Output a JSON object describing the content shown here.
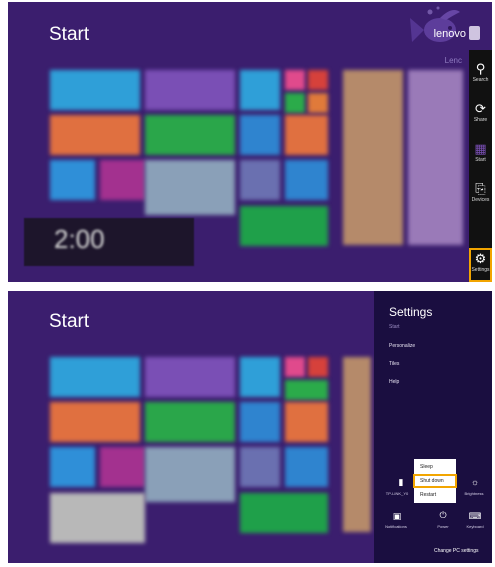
{
  "top": {
    "start_title": "Start",
    "user_name": "lenovo",
    "user_name_faint": "Lenc",
    "clock_time": "2:00",
    "charms": [
      {
        "label": "Search",
        "icon": "search-icon"
      },
      {
        "label": "Share",
        "icon": "share-icon"
      },
      {
        "label": "Start",
        "icon": "windows-logo-icon"
      },
      {
        "label": "Devices",
        "icon": "devices-icon"
      },
      {
        "label": "Settings",
        "icon": "gear-icon"
      }
    ],
    "selected_charm": "Settings"
  },
  "bottom": {
    "start_title": "Start",
    "settings": {
      "title": "Settings",
      "subtitle": "Start",
      "links": [
        "Personalize",
        "Tiles",
        "Help"
      ],
      "power_menu": [
        "Sleep",
        "Shut down",
        "Restart"
      ],
      "highlighted_power_option": "Shut down",
      "tray": {
        "network_label": "TP-LINK_Y0",
        "brightness_label": "Brightness",
        "notifications_label": "Notifications",
        "power_label": "Power",
        "keyboard_label": "Keyboard"
      },
      "change_pc_settings": "Change PC settings"
    }
  },
  "colors": {
    "background": "#3b1e6e",
    "charm_bar": "#111111",
    "settings_pane": "#1a0e40",
    "highlight": "#f2a500"
  }
}
